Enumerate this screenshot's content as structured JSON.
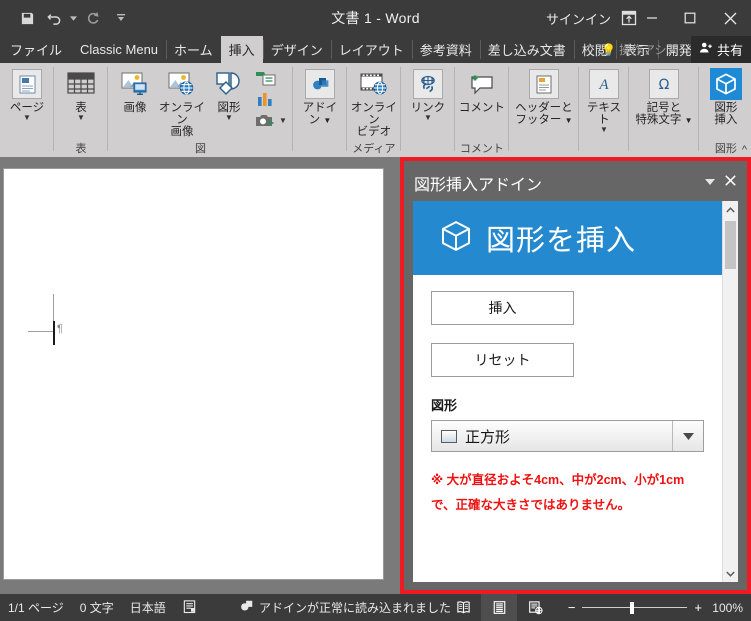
{
  "window": {
    "title": "文書 1 - Word",
    "signin": "サインイン",
    "quick_access": [
      {
        "name": "save-icon",
        "label": "保存"
      },
      {
        "name": "undo-icon",
        "label": "元に戻す"
      },
      {
        "name": "redo-icon",
        "label": "やり直し"
      },
      {
        "name": "customize-qat-icon",
        "label": "クイック アクセス ツール バーのユーザー設定"
      }
    ],
    "ribbon_display_options": "リボンの表示オプション",
    "minimize": "最小化",
    "maximize": "最大化",
    "close": "閉じる"
  },
  "tabs": [
    {
      "label": "ファイル",
      "active": false
    },
    {
      "label": "Classic Menu",
      "active": false
    },
    {
      "label": "ホーム",
      "active": false
    },
    {
      "label": "挿入",
      "active": true
    },
    {
      "label": "デザイン",
      "active": false
    },
    {
      "label": "レイアウト",
      "active": false
    },
    {
      "label": "参考資料",
      "active": false
    },
    {
      "label": "差し込み文書",
      "active": false
    },
    {
      "label": "校閲",
      "active": false
    },
    {
      "label": "表示",
      "active": false
    },
    {
      "label": "開発",
      "active": false
    }
  ],
  "assist": {
    "label": "操作アシス"
  },
  "share": {
    "label": "共有"
  },
  "ribbon": {
    "collapse": "リボンを折りたたむ",
    "groups": [
      {
        "label": "",
        "items": [
          {
            "name": "pages-button",
            "icon": "page-icon",
            "line1": "ページ",
            "line2": "",
            "dropdown": true
          }
        ]
      },
      {
        "label": "表",
        "items": [
          {
            "name": "table-button",
            "icon": "table-icon",
            "line1": "表",
            "line2": "",
            "dropdown": true
          }
        ]
      },
      {
        "label": "図",
        "items": [
          {
            "name": "pictures-button",
            "icon": "picture-icon",
            "line1": "画像",
            "line2": "",
            "dropdown": false
          },
          {
            "name": "online-pictures-button",
            "icon": "online-picture-icon",
            "line1": "オンライン",
            "line2": "画像",
            "dropdown": false
          },
          {
            "name": "shapes-button",
            "icon": "shapes-icon",
            "line1": "図形",
            "line2": "",
            "dropdown": true
          },
          {
            "name": "smartart-button",
            "icon": "smartart-icon",
            "line1": "",
            "line2": "",
            "dropdown": false
          },
          {
            "name": "chart-button",
            "icon": "chart-icon",
            "line1": "",
            "line2": "",
            "dropdown": false
          },
          {
            "name": "screenshot-button",
            "icon": "screenshot-icon",
            "line1": "",
            "line2": "",
            "dropdown": true
          }
        ]
      },
      {
        "label": "",
        "items": [
          {
            "name": "addins-button",
            "icon": "addin-icon",
            "line1": "アドイ",
            "line2": "ン",
            "dropdown": true
          }
        ]
      },
      {
        "label": "メディア",
        "items": [
          {
            "name": "online-video-button",
            "icon": "online-video-icon",
            "line1": "オンライン",
            "line2": "ビデオ",
            "dropdown": false
          }
        ]
      },
      {
        "label": "",
        "items": [
          {
            "name": "links-button",
            "icon": "link-icon",
            "line1": "リンク",
            "line2": "",
            "dropdown": true
          }
        ]
      },
      {
        "label": "コメント",
        "items": [
          {
            "name": "comment-button",
            "icon": "comment-icon",
            "line1": "コメント",
            "line2": "",
            "dropdown": false
          }
        ]
      },
      {
        "label": "",
        "items": [
          {
            "name": "header-footer-button",
            "icon": "header-footer-icon",
            "line1": "ヘッダーと",
            "line2": "フッター",
            "dropdown": true
          }
        ]
      },
      {
        "label": "",
        "items": [
          {
            "name": "text-button",
            "icon": "text-icon",
            "line1": "テキスト",
            "line2": "",
            "dropdown": true
          }
        ]
      },
      {
        "label": "",
        "items": [
          {
            "name": "symbols-button",
            "icon": "symbol-icon",
            "line1": "記号と",
            "line2": "特殊文字",
            "dropdown": true
          }
        ]
      },
      {
        "label": "図形",
        "items": [
          {
            "name": "insert-shape-addin-button",
            "icon": "cube-icon",
            "line1": "図形",
            "line2": "挿入",
            "dropdown": false
          }
        ]
      }
    ]
  },
  "task_pane": {
    "title": "図形挿入アドイン",
    "dropdown_tooltip": "タスク ウィンドウのオプション",
    "close_tooltip": "閉じる",
    "banner": {
      "icon": "cube-icon",
      "text": "図形を挿入"
    },
    "insert_button": "挿入",
    "reset_button": "リセット",
    "shape_field_label": "図形",
    "shape_select_value": "正方形",
    "shape_select_icon": "square-icon",
    "note": "※ 大が直径およそ4cm、中が2cm、小が1cmで、正確な大きさではありません。",
    "highlight_color": "#ee1c22",
    "banner_color": "#2489ce",
    "note_color": "#ee1111"
  },
  "status_bar": {
    "page": "1/1 ページ",
    "words": "0 文字",
    "language": "日本語",
    "proofing_icon": "proofing-icon",
    "addin_icon": "addin-status-icon",
    "addin_message": "アドインが正常に読み込まれました",
    "views": [
      {
        "name": "read-mode-view-button",
        "label": "閲覧モード",
        "active": false
      },
      {
        "name": "print-layout-view-button",
        "label": "印刷レイアウト",
        "active": true
      },
      {
        "name": "web-layout-view-button",
        "label": "Web レイアウト",
        "active": false
      }
    ],
    "zoom_out": "−",
    "zoom_in": "+",
    "zoom_level": "100%"
  }
}
